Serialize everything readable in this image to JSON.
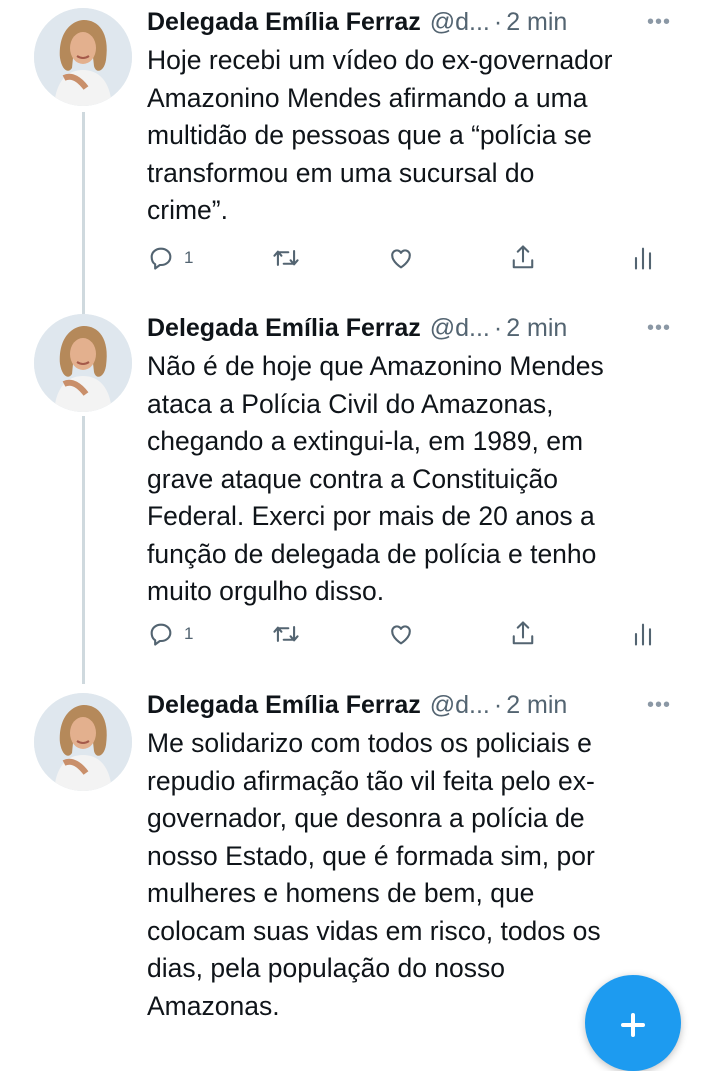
{
  "tweets": [
    {
      "author_name": "Delegada Emília Ferraz",
      "handle": "@d...",
      "separator": "·",
      "time": "2 min",
      "more_icon": "more-horizontal-icon",
      "text": "Hoje recebi um vídeo do ex-governador\nAmazonino Mendes afirmando a uma\nmultidão de pessoas que a “polícia se\ntransformou em uma sucursal do\ncrime”.",
      "reply_count": "1"
    },
    {
      "author_name": "Delegada Emília Ferraz",
      "handle": "@d...",
      "separator": "·",
      "time": "2 min",
      "more_icon": "more-horizontal-icon",
      "text": "Não é de hoje que Amazonino Mendes\nataca a Polícia Civil do Amazonas,\nchegando a extingui-la, em 1989, em\ngrave ataque contra a Constituição\nFederal. Exerci por mais de 20 anos a\nfunção de delegada de polícia e tenho\nmuito orgulho disso.",
      "reply_count": "1"
    },
    {
      "author_name": "Delegada Emília Ferraz",
      "handle": "@d...",
      "separator": "·",
      "time": "2 min",
      "more_icon": "more-horizontal-icon",
      "text": "Me solidarizo com todos os policiais e\nrepudio afirmação tão vil feita pelo ex-\ngovernador, que desonra a polícia de\nnosso Estado, que é formada sim, por\nmulheres e homens de bem, que\ncolocam suas vidas em risco, todos os\ndias, pela população do nosso\nAmazonas."
    }
  ],
  "icons": {
    "reply": "reply-icon",
    "retweet": "retweet-icon",
    "like": "heart-icon",
    "share": "share-icon",
    "analytics": "analytics-icon",
    "compose": "compose-plus-icon"
  },
  "colors": {
    "accent": "#1d9bf0",
    "text": "#0f1419",
    "muted": "#536471",
    "thread_line": "#cfd9de"
  }
}
